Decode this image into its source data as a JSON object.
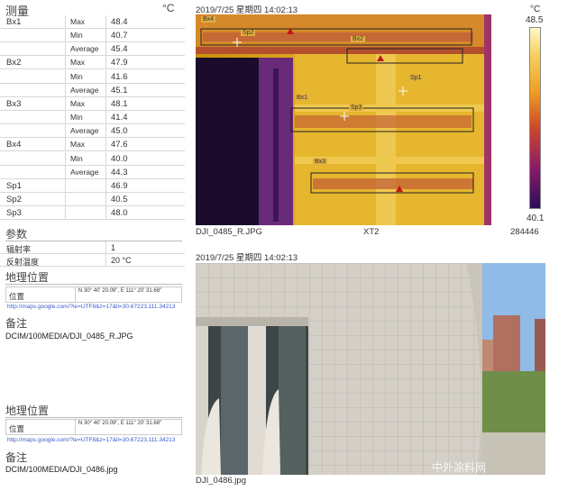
{
  "panel": {
    "title": "测量",
    "unit": "°C",
    "rows": [
      {
        "name": "Bx1",
        "stat": "Max",
        "value": "48.4"
      },
      {
        "name": "",
        "stat": "Min",
        "value": "40.7"
      },
      {
        "name": "",
        "stat": "Average",
        "value": "45.4"
      },
      {
        "name": "Bx2",
        "stat": "Max",
        "value": "47.9"
      },
      {
        "name": "",
        "stat": "Min",
        "value": "41.6"
      },
      {
        "name": "",
        "stat": "Average",
        "value": "45.1"
      },
      {
        "name": "Bx3",
        "stat": "Max",
        "value": "48.1"
      },
      {
        "name": "",
        "stat": "Min",
        "value": "41.4"
      },
      {
        "name": "",
        "stat": "Average",
        "value": "45.0"
      },
      {
        "name": "Bx4",
        "stat": "Max",
        "value": "47.6"
      },
      {
        "name": "",
        "stat": "Min",
        "value": "40.0"
      },
      {
        "name": "",
        "stat": "Average",
        "value": "44.3"
      },
      {
        "name": "Sp1",
        "stat": "",
        "value": "46.9"
      },
      {
        "name": "Sp2",
        "stat": "",
        "value": "40.5"
      },
      {
        "name": "Sp3",
        "stat": "",
        "value": "48.0"
      }
    ],
    "params_title": "参数",
    "params": [
      {
        "key": "辐射率",
        "value": "1"
      },
      {
        "key": "反射温度",
        "value": "20 °C"
      }
    ],
    "geo_title": "地理位置",
    "geo_key": "位置",
    "geo_value": "N 30° 40' 20.09\", E 111° 20' 31.68\"",
    "geo_link": "http://maps.google.com/?ie=UTF8&z=17&ll=30.67223,111.34213",
    "note_title": "备注",
    "note_path": "DCIM/100MEDIA/DJI_0485_R.JPG",
    "geo2_title": "地理位置",
    "geo2_key": "位置",
    "geo2_value": "N 30° 40' 20.09\", E 111° 20' 31.68\"",
    "geo2_link": "http://maps.google.com/?ie=UTF8&z=17&ll=30.67223,111.34213",
    "note2_title": "备注",
    "note2_path": "DCIM/100MEDIA/DJI_0486.jpg"
  },
  "thermal": {
    "timestamp": "2019/7/25 星期四 14:02:13",
    "filename": "DJI_0485_R.JPG",
    "camera": "XT2",
    "serial": "284446",
    "scale_unit": "°C",
    "scale_max": "48.5",
    "scale_min": "40.1",
    "labels": {
      "bx4": "Bx4",
      "bx2": "Bx2",
      "bx1": "Bx1",
      "bx3": "Bx3",
      "sp1": "Sp1",
      "sp2": "Sp2",
      "sp3": "Sp3"
    }
  },
  "photo": {
    "timestamp": "2019/7/25 星期四 14:02:13",
    "filename": "DJI_0486.jpg",
    "watermark": "中外涂料网"
  },
  "colors": {
    "accent_link": "#3a5ccc",
    "hot": "#f0c040",
    "cold": "#2a0e5a"
  }
}
